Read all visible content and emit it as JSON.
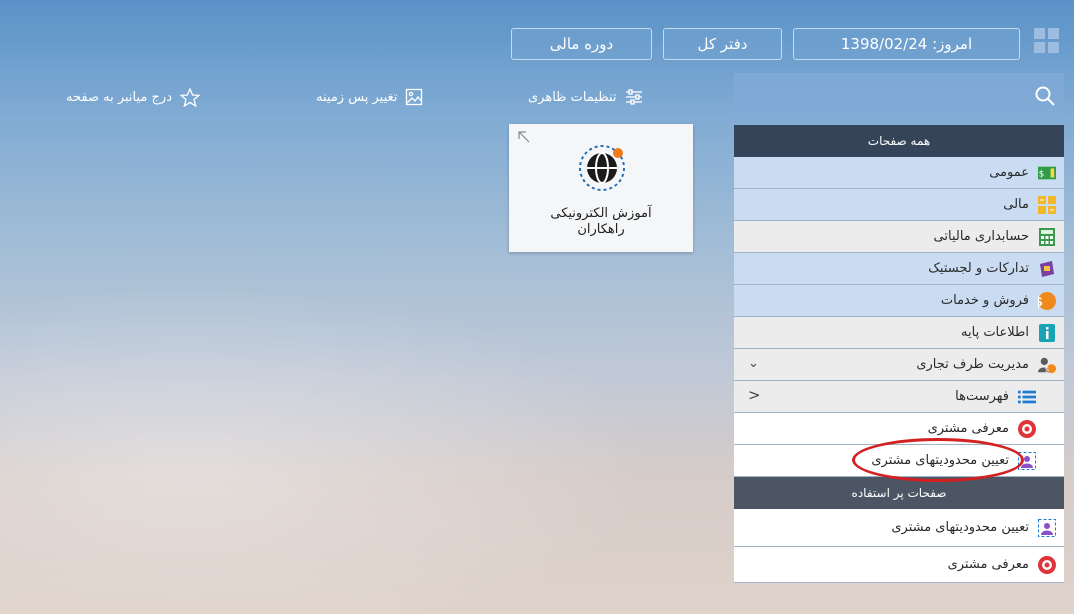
{
  "topbar": {
    "today_label": "امروز: 1398/02/24",
    "ledger_label": "دفتر کل",
    "period_label": "دوره مالی"
  },
  "toolbar": {
    "appearance_label": "تنظیمات ظاهری",
    "background_label": "تغییر پس زمینه",
    "shortcut_label": "درج میانبر به صفحه"
  },
  "tile": {
    "line1": "آموزش الکترونیکی",
    "line2": "راهکاران"
  },
  "sidebar": {
    "all_pages_header": "همه صفحات",
    "items": [
      {
        "label": "عمومی",
        "icon": "money-icon",
        "style": "blue"
      },
      {
        "label": "مالی",
        "icon": "calc-grid-icon",
        "style": "blue"
      },
      {
        "label": "حسابداری مالیاتی",
        "icon": "calculator-icon",
        "style": "grey"
      },
      {
        "label": "تدارکات و لجستیک",
        "icon": "box-icon",
        "style": "blue"
      },
      {
        "label": "فروش و خدمات",
        "icon": "dollar-coin-icon",
        "style": "blue"
      },
      {
        "label": "اطلاعات پایه",
        "icon": "info-icon",
        "style": "grey"
      },
      {
        "label": "مدیریت طرف تجاری",
        "icon": "business-partner-icon",
        "style": "grey"
      },
      {
        "label": "فهرست‌ها",
        "icon": "list-icon",
        "style": "grey"
      },
      {
        "label": "معرفی مشتری",
        "icon": "customer-intro-icon",
        "style": "white"
      },
      {
        "label": "تعیین محدودیتهای مشتری",
        "icon": "customer-limits-icon",
        "style": "white"
      }
    ],
    "frequent_header": "صفحات پر استفاده",
    "frequent": [
      {
        "label": "تعیین محدودیتهای مشتری",
        "icon": "customer-limits-icon"
      },
      {
        "label": "معرفی مشتری",
        "icon": "customer-intro-icon"
      }
    ]
  },
  "colors": {
    "header_bg": "#354458",
    "row_blue": "#c9dcf2",
    "row_grey": "#ececec",
    "highlight": "#d32020"
  }
}
